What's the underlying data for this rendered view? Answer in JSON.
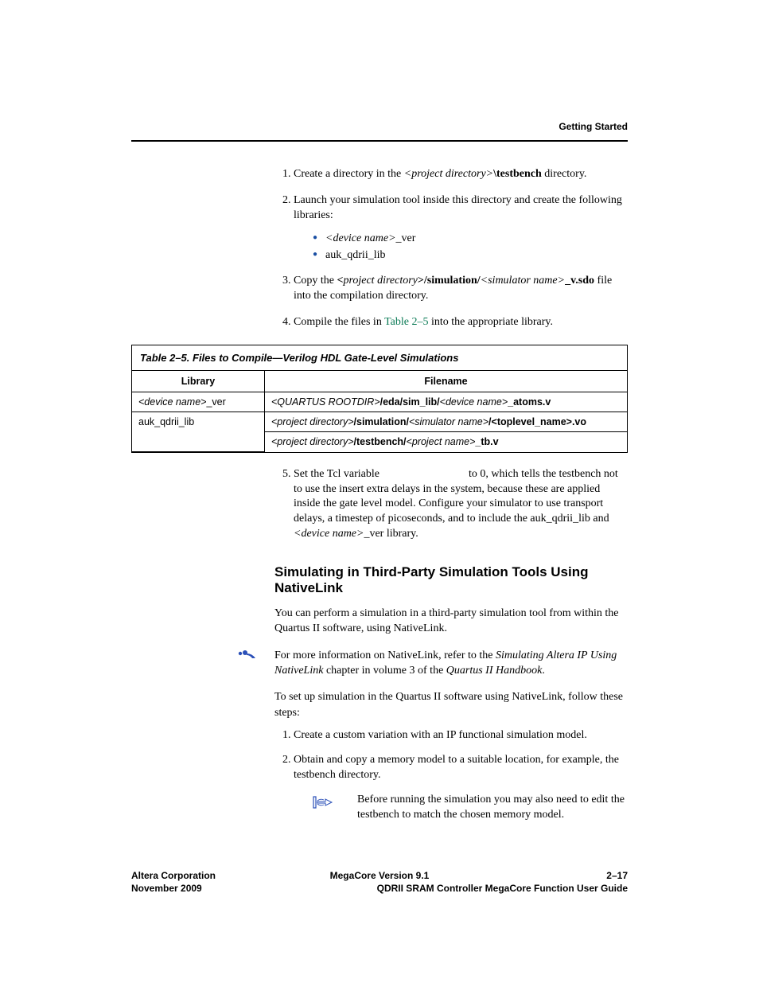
{
  "header": {
    "section": "Getting Started"
  },
  "list1": {
    "i1": {
      "pre": "Create a directory in the ",
      "proj": "<project directory>",
      "post": "\\testbench",
      "tail": " directory."
    },
    "i2": "Launch your simulation tool inside this directory and create the following libraries:",
    "b1": {
      "dev": "<device name>",
      "suf": "_ver"
    },
    "b2": "auk_qdrii_lib",
    "i3": {
      "pre": "Copy the ",
      "p1": "<",
      "proj": "project directory",
      "p2": ">/simulation/",
      "sim": "<simulator name>",
      "p3": "_v.sdo",
      "tail": " file into the compilation directory."
    },
    "i4": {
      "pre": "Compile the files in ",
      "link": "Table 2–5",
      "post": " into the appropriate library."
    }
  },
  "table": {
    "caption": "Table 2–5. Files to Compile—Verilog HDL Gate-Level Simulations",
    "h1": "Library",
    "h2": "Filename",
    "r1c1": {
      "a": "<device name>",
      "b": "_ver"
    },
    "r1c2": {
      "a": "<QUARTUS ROOTDIR>",
      "b": "/eda/sim_lib/",
      "c": "<device name>",
      "d": "_atoms.v"
    },
    "r2c1": "auk_qdrii_lib",
    "r2c2": {
      "a": "<project directory>",
      "b": "/simulation/",
      "c": "<simulator name>",
      "d": "/<toplevel_name>.vo"
    },
    "r3c2": {
      "a": "<project directory>",
      "b": "/testbench/",
      "c": "<project name>",
      "d": "_tb.v"
    }
  },
  "list1_cont": {
    "i5": {
      "a": "Set the Tcl variable ",
      "gap": "                              ",
      "b": " to 0, which tells the testbench not to use the insert extra delays in the system, because these are applied inside the gate level model. Configure your simulator to use transport delays, a timestep of picoseconds, and to include the auk_qdrii_lib and ",
      "dev": "<device name>",
      "c": "_ver library."
    }
  },
  "heading2": "Simulating in Third-Party Simulation Tools Using NativeLink",
  "para1": "You can perform a simulation in a third-party simulation tool from within the Quartus II software, using NativeLink.",
  "ref": {
    "a": "For more information on NativeLink, refer to the ",
    "t1": "Simulating Altera IP Using NativeLink",
    "b": " chapter in volume 3 of the ",
    "t2": "Quartus II Handbook",
    "c": "."
  },
  "para2": "To set up simulation in the Quartus II software using NativeLink, follow these steps:",
  "list2": {
    "i1": "Create a custom variation with an IP functional simulation model.",
    "i2": "Obtain and copy a memory model to a suitable location, for example, the testbench directory."
  },
  "note": "Before running the simulation you may also need to edit the testbench to match the chosen memory model.",
  "footer": {
    "l1": "Altera Corporation",
    "c1": "MegaCore Version 9.1",
    "r1": "2–17",
    "l2": "November 2009",
    "r2": "QDRII SRAM Controller MegaCore Function User Guide"
  }
}
